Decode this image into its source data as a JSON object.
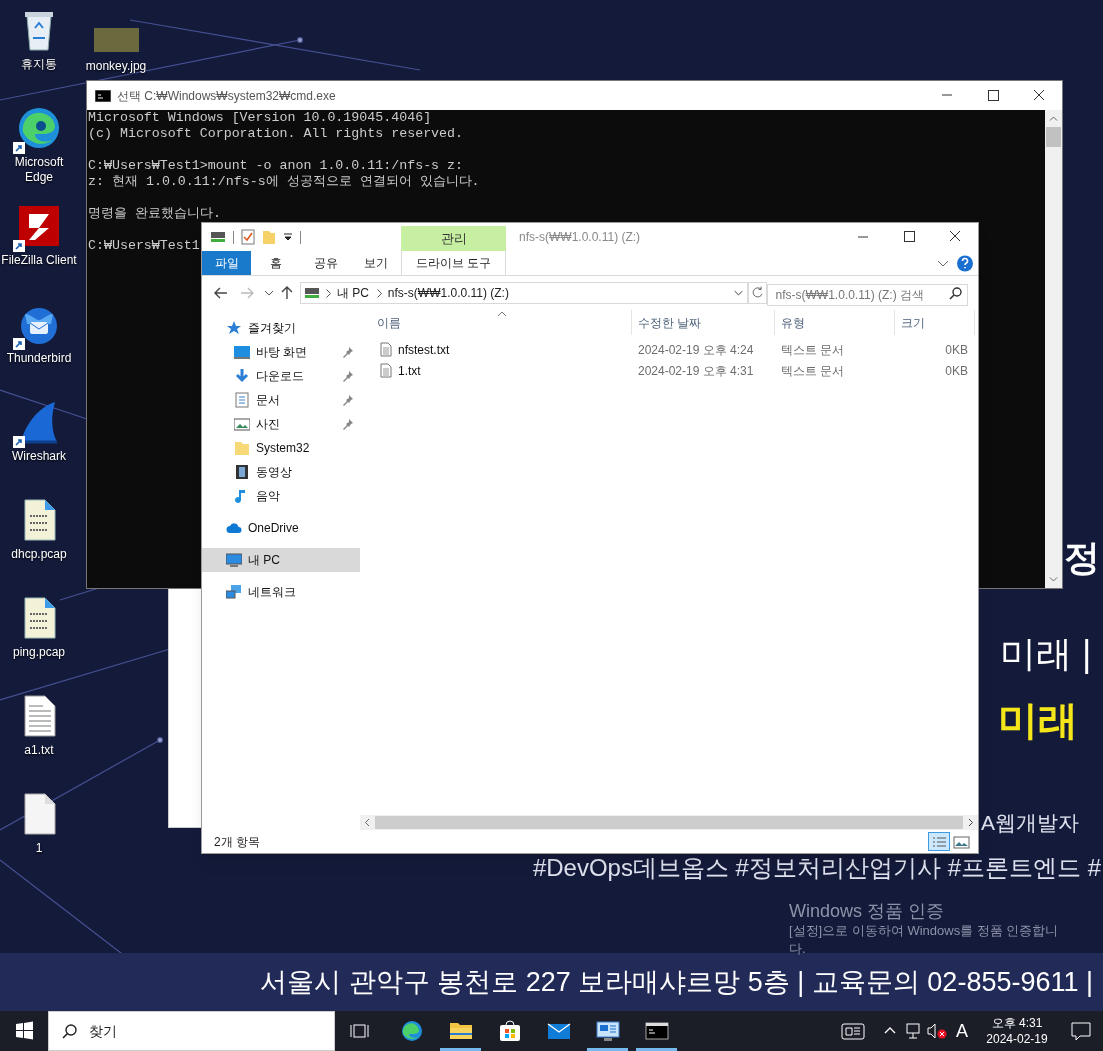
{
  "desktop_icons": [
    {
      "label": "휴지통",
      "kind": "recycle",
      "shortcut": false
    },
    {
      "label": "Microsoft Edge",
      "kind": "edge",
      "shortcut": true
    },
    {
      "label": "FileZilla Client",
      "kind": "filezilla",
      "shortcut": true
    },
    {
      "label": "Thunderbird",
      "kind": "thunderbird",
      "shortcut": true
    },
    {
      "label": "Wireshark",
      "kind": "wireshark",
      "shortcut": true
    },
    {
      "label": "dhcp.pcap",
      "kind": "pcap",
      "shortcut": false
    },
    {
      "label": "ping.pcap",
      "kind": "pcap",
      "shortcut": false
    },
    {
      "label": "a1.txt",
      "kind": "txt",
      "shortcut": false
    },
    {
      "label": "1",
      "kind": "blank",
      "shortcut": false
    }
  ],
  "desktop_photo_icon": {
    "label": "monkey.jpg"
  },
  "wallpaper": {
    "big_char": "정",
    "slogan_line": "미래 |",
    "slogan_highlight": "미래",
    "tag_line_1": "A웹개발자",
    "tag_line_2": "#DevOps데브옵스 #정보처리산업기사 #프론트엔드 #",
    "banner": "서울시 관악구 봉천로 227 보라매샤르망 5층  |  교육문의 02-855-9611  |"
  },
  "activation_notice": {
    "title": "Windows 정품 인증",
    "text": "[설정]으로 이동하여 Windows를 정품 인증합니다."
  },
  "cmd_window": {
    "title": "선택 C:₩Windows₩system32₩cmd.exe",
    "blocks": [
      [
        "Microsoft Windows [Version 10.0.19045.4046]",
        "(c) Microsoft Corporation. All rights reserved."
      ],
      [
        "C:₩Users₩Test1>mount -o anon 1.0.0.11:/nfs-s z:",
        "z: 현재 1.0.0.11:/nfs-s에 성공적으로 연결되어 있습니다."
      ],
      [
        "명령을 완료했습니다."
      ],
      [
        "C:₩Users₩Test1"
      ]
    ]
  },
  "explorer": {
    "context_header": "관리",
    "title": "nfs-s(₩₩1.0.0.11) (Z:)",
    "ribbon_tabs": [
      {
        "label": "파일",
        "kind": "file"
      },
      {
        "label": "홈",
        "kind": "tab"
      },
      {
        "label": "공유",
        "kind": "tab"
      },
      {
        "label": "보기",
        "kind": "tab"
      },
      {
        "label": "드라이브 도구",
        "kind": "context"
      }
    ],
    "breadcrumbs": [
      "내 PC",
      "nfs-s(₩₩1.0.0.11) (Z:)"
    ],
    "search": {
      "placeholder": "nfs-s(₩₩1.0.0.11) (Z:) 검색"
    },
    "nav_pane": {
      "items": [
        {
          "label": "즐겨찾기",
          "kind": "star",
          "selected": false,
          "children": [
            {
              "label": "바탕 화면",
              "kind": "desktop",
              "selected": false,
              "pinned": true
            },
            {
              "label": "다운로드",
              "kind": "download",
              "selected": false,
              "pinned": true
            },
            {
              "label": "문서",
              "kind": "document",
              "selected": false,
              "pinned": true
            },
            {
              "label": "사진",
              "kind": "pictures",
              "selected": false,
              "pinned": true
            },
            {
              "label": "System32",
              "kind": "folder",
              "selected": false,
              "pinned": false
            },
            {
              "label": "동영상",
              "kind": "video",
              "selected": false,
              "pinned": false
            },
            {
              "label": "음악",
              "kind": "music",
              "selected": false,
              "pinned": false
            }
          ]
        },
        {
          "label": "OneDrive",
          "kind": "cloud",
          "selected": false
        },
        {
          "label": "내 PC",
          "kind": "pc",
          "selected": true
        },
        {
          "label": "네트워크",
          "kind": "network",
          "selected": false
        }
      ]
    },
    "columns": [
      "이름",
      "수정한 날짜",
      "유형",
      "크기"
    ],
    "rows": [
      {
        "name": "nfstest.txt",
        "date": "2024-02-19 오후 4:24",
        "type": "텍스트 문서",
        "size": "0KB"
      },
      {
        "name": "1.txt",
        "date": "2024-02-19 오후 4:31",
        "type": "텍스트 문서",
        "size": "0KB"
      }
    ],
    "status": "2개 항목",
    "view_buttons": [
      {
        "kind": "details",
        "selected": true
      },
      {
        "kind": "large-icons",
        "selected": false
      }
    ]
  },
  "taskbar": {
    "search": {
      "placeholder": "찾기"
    },
    "apps": [
      {
        "kind": "edge",
        "running": false
      },
      {
        "kind": "explorer",
        "running": true
      },
      {
        "kind": "store",
        "running": false
      },
      {
        "kind": "mail",
        "running": false
      },
      {
        "kind": "remote",
        "running": true
      },
      {
        "kind": "terminal",
        "running": true
      }
    ],
    "ime_indicator": "A",
    "time": "오후 4:31",
    "date": "2024-02-19"
  }
}
